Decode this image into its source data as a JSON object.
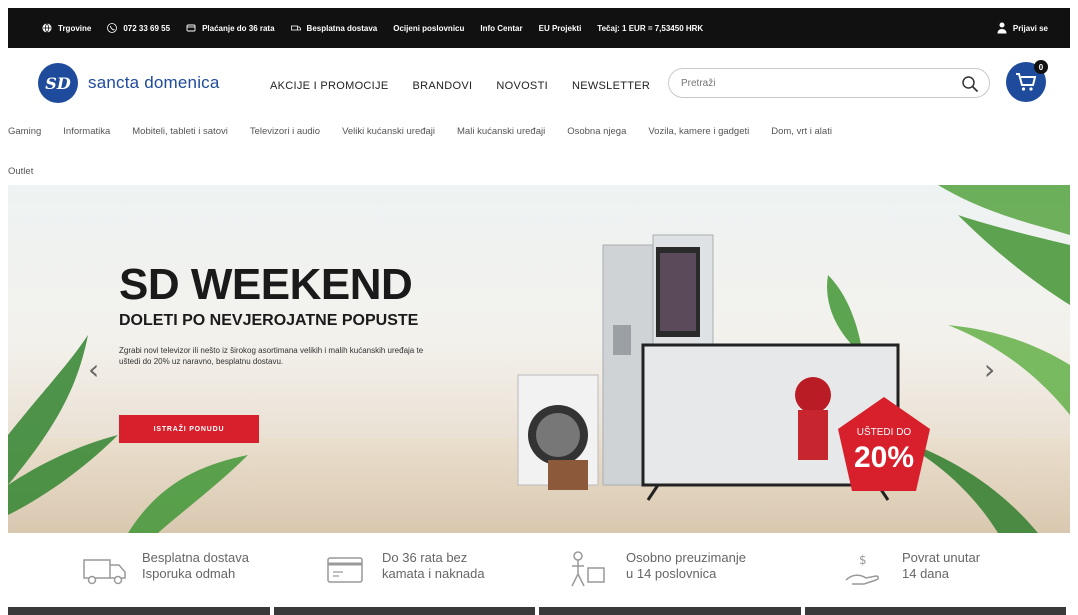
{
  "topbar": {
    "items": [
      {
        "icon": "globe-icon",
        "label": "Trgovine"
      },
      {
        "icon": "phone-icon",
        "label": "072 33 69 55"
      },
      {
        "icon": "card-icon",
        "label": "Plaćanje do 36 rata"
      },
      {
        "icon": "truck-icon",
        "label": "Besplatna dostava"
      },
      {
        "icon": "",
        "label": "Ocijeni poslovnicu"
      },
      {
        "icon": "",
        "label": "Info Centar"
      },
      {
        "icon": "",
        "label": "EU Projekti"
      },
      {
        "icon": "",
        "label": "Tečaj: 1 EUR = 7,53450 HRK"
      }
    ],
    "login": "Prijavi se"
  },
  "header": {
    "logo_mark": "SD",
    "logo_text": "sancta domenica",
    "nav": [
      "AKCIJE I PROMOCIJE",
      "BRANDOVI",
      "NOVOSTI",
      "NEWSLETTER"
    ],
    "search_placeholder": "Pretraži",
    "cart_count": "0"
  },
  "categories": {
    "row1": [
      "Gaming",
      "Informatika",
      "Mobiteli, tableti i satovi",
      "Televizori i audio",
      "Veliki kućanski uređaji",
      "Mali kućanski uređaji",
      "Osobna njega",
      "Vozila, kamere i gadgeti",
      "Dom, vrt i alati"
    ],
    "row2": [
      "Outlet"
    ]
  },
  "hero": {
    "title": "SD WEEKEND",
    "subtitle": "DOLETI PO NEVJEROJATNE POPUSTE",
    "description": "Zgrabi novi televizor ili nešto iz širokog asortimana velikih i malih kućanskih uređaja te uštedi do 20% uz naravno, besplatnu dostavu.",
    "cta": "ISTRAŽI PONUDU",
    "badge_line1": "UŠTEDI DO",
    "badge_line2": "20%",
    "prev_arrow": "‹",
    "next_arrow": "›"
  },
  "features": [
    {
      "icon": "delivery-truck-icon",
      "line1": "Besplatna dostava",
      "line2": "Isporuka odmah"
    },
    {
      "icon": "credit-card-icon",
      "line1": "Do 36 rata bez",
      "line2": "kamata i naknada"
    },
    {
      "icon": "pickup-person-icon",
      "line1": "Osobno preuzimanje",
      "line2": "u 14 poslovnica"
    },
    {
      "icon": "money-return-icon",
      "line1": "Povrat unutar",
      "line2": "14 dana"
    }
  ],
  "colors": {
    "brand_blue": "#1e4b9b",
    "accent_red": "#d8202d",
    "topbar_bg": "#111111"
  }
}
